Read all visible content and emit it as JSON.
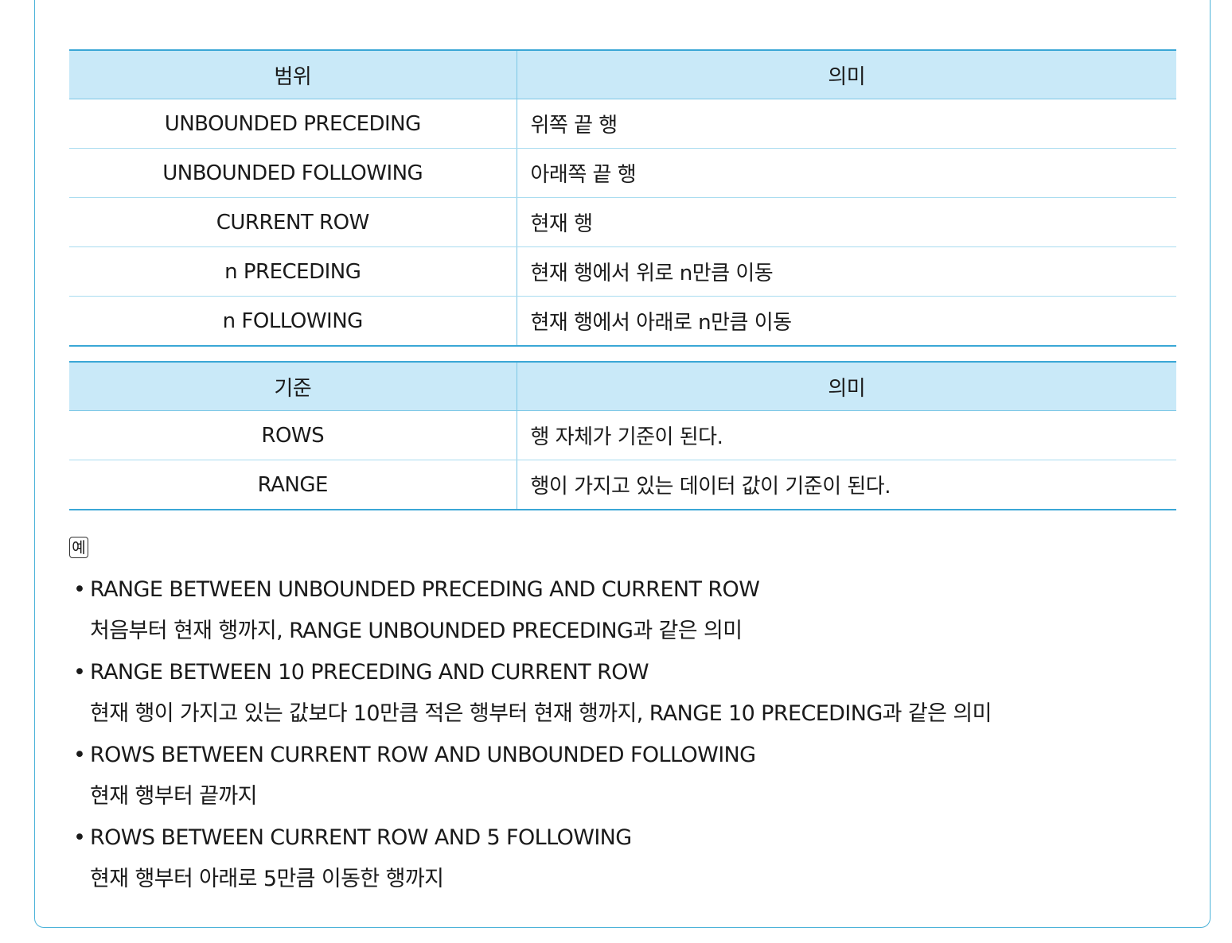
{
  "range_table": {
    "headers": [
      "범위",
      "의미"
    ],
    "rows": [
      {
        "key": "UNBOUNDED PRECEDING",
        "meaning": "위쪽 끝 행"
      },
      {
        "key": "UNBOUNDED FOLLOWING",
        "meaning": "아래쪽 끝 행"
      },
      {
        "key": "CURRENT ROW",
        "meaning": "현재 행"
      },
      {
        "key": "n PRECEDING",
        "meaning": "현재 행에서 위로 n만큼 이동"
      },
      {
        "key": "n FOLLOWING",
        "meaning": "현재 행에서 아래로 n만큼 이동"
      }
    ]
  },
  "basis_table": {
    "headers": [
      "기준",
      "의미"
    ],
    "rows": [
      {
        "key": "ROWS",
        "meaning": "행 자체가 기준이 된다."
      },
      {
        "key": "RANGE",
        "meaning": "행이 가지고 있는 데이터 값이 기준이 된다."
      }
    ]
  },
  "example_label": "예",
  "bullet": "•",
  "examples": [
    {
      "code": "RANGE BETWEEN UNBOUNDED PRECEDING AND CURRENT ROW",
      "desc": "처음부터 현재 행까지, RANGE UNBOUNDED PRECEDING과 같은 의미"
    },
    {
      "code": "RANGE BETWEEN 10 PRECEDING AND CURRENT ROW",
      "desc": "현재 행이 가지고 있는 값보다 10만큼 적은 행부터 현재 행까지, RANGE 10 PRECEDING과 같은 의미"
    },
    {
      "code": "ROWS BETWEEN CURRENT ROW AND UNBOUNDED FOLLOWING",
      "desc": "현재 행부터 끝까지"
    },
    {
      "code": "ROWS BETWEEN CURRENT ROW AND 5 FOLLOWING",
      "desc": "현재 행부터 아래로 5만큼 이동한 행까지"
    }
  ],
  "colors": {
    "header_bg": "#c9e9f8",
    "rule": "#3aa7d6",
    "frame": "#4db3d9"
  }
}
